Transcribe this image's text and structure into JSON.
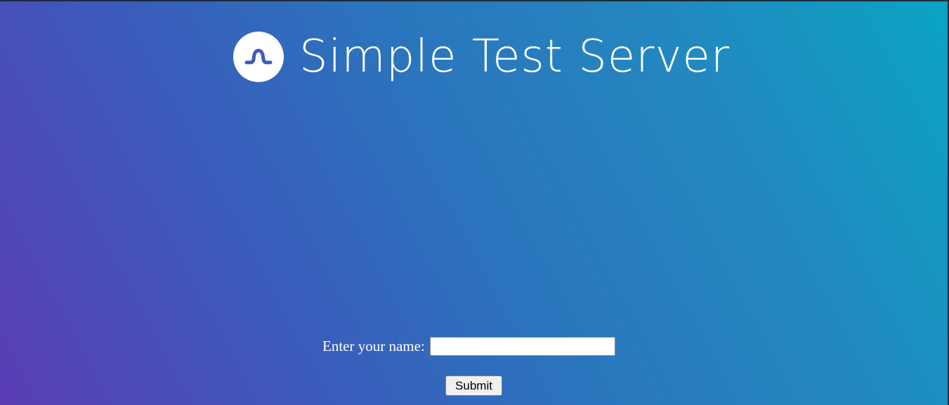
{
  "header": {
    "title": "Simple Test Server",
    "logo_icon": "wave-logo-icon"
  },
  "form": {
    "label": "Enter your name:",
    "input_value": "",
    "submit_label": "Submit"
  },
  "colors": {
    "gradient_start": "#5a3db5",
    "gradient_mid": "#2b74bd",
    "gradient_end": "#0aa4c3",
    "logo_mark": "#3a5bbd"
  }
}
